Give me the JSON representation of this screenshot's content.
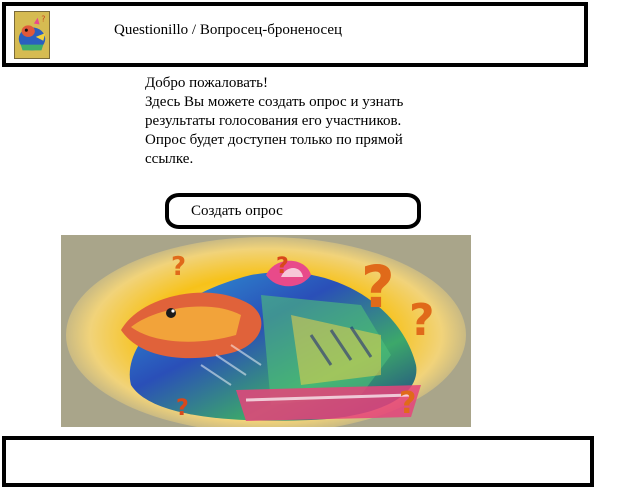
{
  "header": {
    "title": "Questionillo / Вопросец-броненосец",
    "logo_icon": "armadillo-logo-icon"
  },
  "intro": {
    "greeting": "Добро пожаловать!",
    "line1": "Здесь Вы можете создать опрос и узнать",
    "line2": "результаты голосования его участников.",
    "line3": "Опрос будет доступен только по прямой",
    "line4": "ссылке."
  },
  "actions": {
    "create_poll_label": "Создать опрос"
  },
  "hero": {
    "icon": "armadillo-question-marks-illustration"
  },
  "colors": {
    "border": "#000000",
    "background": "#ffffff",
    "hero_backdrop": "#a9a58a",
    "hero_glow": "#f7c21a"
  }
}
